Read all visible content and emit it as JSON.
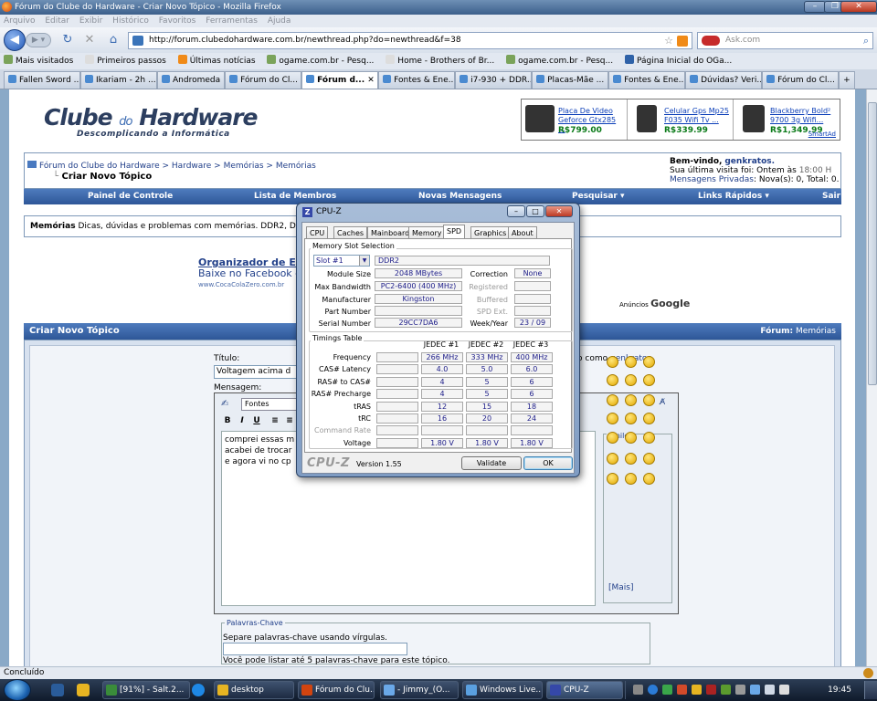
{
  "window": {
    "title": "Fórum do Clube do Hardware - Criar Novo Tópico - Mozilla Firefox"
  },
  "menu": [
    "Arquivo",
    "Editar",
    "Exibir",
    "Histórico",
    "Favoritos",
    "Ferramentas",
    "Ajuda"
  ],
  "nav": {
    "url": "http://forum.clubedohardware.com.br/newthread.php?do=newthread&f=38",
    "search_placeholder": "Ask.com"
  },
  "bookmarks": [
    "Mais visitados",
    "Primeiros passos",
    "Últimas notícias",
    "ogame.com.br - Pesq...",
    "Home - Brothers of Br...",
    "ogame.com.br - Pesq...",
    "Página Inicial do OGa..."
  ],
  "tabs": [
    {
      "label": "Fallen Sword ...",
      "active": false
    },
    {
      "label": "Ikariam - 2h ...",
      "active": false
    },
    {
      "label": "Andromeda",
      "active": false
    },
    {
      "label": "Fórum do Cl...",
      "active": false
    },
    {
      "label": "Fórum d...",
      "active": true
    },
    {
      "label": "Fontes & Ene...",
      "active": false
    },
    {
      "label": "i7-930 + DDR...",
      "active": false
    },
    {
      "label": "Placas-Mãe ...",
      "active": false
    },
    {
      "label": "Fontes & Ene...",
      "active": false
    },
    {
      "label": "Dúvidas? Veri...",
      "active": false
    },
    {
      "label": "Fórum do Cl...",
      "active": false
    }
  ],
  "site": {
    "logo_a": "Clube",
    "logo_do": "do",
    "logo_b": "Hardware",
    "slogan": "Descomplicando a Informática",
    "ads": [
      {
        "title": "Placa De Video Geforce Gtx285 ...",
        "price": "R$799.00"
      },
      {
        "title": "Celular Gps Mp25 F035 Wifi Tv ...",
        "price": "R$339.99"
      },
      {
        "title": "Blackberry Bold² 9700 3g Wifi...",
        "price": "R$1,349.99"
      }
    ],
    "smartad": "SmartAd",
    "breadcrumb": "Fórum do Clube do Hardware > Hardware > Memórias > Memórias",
    "page_title": "Criar Novo Tópico",
    "welcome_prefix": "Bem-vindo,",
    "username": "genkratos.",
    "last_visit_label": "Sua última visita foi: Ontem às",
    "last_visit_time": "18:00 H",
    "pm_label": "Mensagens Privadas",
    "pm_counts": ": Nova(s): 0, Total: 0.",
    "navstrip": [
      "Painel de Controle",
      "Lista de Membros",
      "Novas Mensagens",
      "Pesquisar ▾",
      "Links Rápidos ▾",
      "Sair"
    ],
    "forum_name": "Memórias",
    "forum_desc": "Dicas, dúvidas e problemas com memórias. DDR2, DD",
    "promo_title": "Organizador de Eve",
    "promo_sub": "Baixe no Facebook e j",
    "promo_url": "www.CocaColaZero.com.br",
    "anuncios": "Anúncios",
    "google": "Google",
    "form_title": "Criar Novo Tópico",
    "forum_label": "Fórum:",
    "forum_label_value": "Memórias",
    "title_label": "Título:",
    "title_value": "Voltagem acima d",
    "post_as": "o como",
    "post_as_user": "genkratos",
    "message_label": "Mensagem:",
    "font_select": "Fontes",
    "fmt_buttons": [
      "B",
      "I",
      "U",
      "≡",
      "≡"
    ],
    "message_lines": [
      "comprei essas m",
      "acabei de trocar",
      "e agora vi no cp"
    ],
    "smilies_label": "Smiles",
    "more_smilies": "[Mais]",
    "keywords_label": "Palavras-Chave",
    "keywords_hint": "Separe palavras-chave usando vírgulas.",
    "keywords_limit": "Você pode listar até 5 palavras-chave para este tópico."
  },
  "status": {
    "text": "Concluído"
  },
  "taskbar": {
    "buttons": [
      {
        "label": "[91%] - Salt.2...",
        "active": false
      },
      {
        "label": "desktop",
        "active": false
      },
      {
        "label": "Fórum do Clu...",
        "active": false
      },
      {
        "label": "- Jimmy_(O...",
        "active": false
      },
      {
        "label": "Windows Live...",
        "active": false
      },
      {
        "label": "CPU-Z",
        "active": true
      }
    ],
    "clock": "19:45"
  },
  "cpuz": {
    "title": "CPU-Z",
    "tabs": [
      "CPU",
      "Caches",
      "Mainboard",
      "Memory",
      "SPD",
      "Graphics",
      "About"
    ],
    "active_tab": "SPD",
    "slot_group": "Memory Slot Selection",
    "slot": "Slot #1",
    "type": "DDR2",
    "module_size_label": "Module Size",
    "module_size": "2048 MBytes",
    "max_bw_label": "Max Bandwidth",
    "max_bw": "PC2-6400 (400 MHz)",
    "manufacturer_label": "Manufacturer",
    "manufacturer": "Kingston",
    "part_label": "Part Number",
    "part": "",
    "serial_label": "Serial Number",
    "serial": "29CC7DA6",
    "correction_label": "Correction",
    "correction": "None",
    "registered_label": "Registered",
    "buffered_label": "Buffered",
    "spd_ext_label": "SPD Ext.",
    "week_year_label": "Week/Year",
    "week_year": "23 / 09",
    "timings_group": "Timings Table",
    "timing_headers": [
      "JEDEC #1",
      "JEDEC #2",
      "JEDEC #3"
    ],
    "timing_rows": [
      {
        "label": "Frequency",
        "values": [
          "266 MHz",
          "333 MHz",
          "400 MHz"
        ],
        "disabled": false
      },
      {
        "label": "CAS# Latency",
        "values": [
          "4.0",
          "5.0",
          "6.0"
        ],
        "disabled": false
      },
      {
        "label": "RAS# to CAS#",
        "values": [
          "4",
          "5",
          "6"
        ],
        "disabled": false
      },
      {
        "label": "RAS# Precharge",
        "values": [
          "4",
          "5",
          "6"
        ],
        "disabled": false
      },
      {
        "label": "tRAS",
        "values": [
          "12",
          "15",
          "18"
        ],
        "disabled": false
      },
      {
        "label": "tRC",
        "values": [
          "16",
          "20",
          "24"
        ],
        "disabled": false
      },
      {
        "label": "Command Rate",
        "values": [
          "",
          "",
          ""
        ],
        "disabled": true
      },
      {
        "label": "Voltage",
        "values": [
          "1.80 V",
          "1.80 V",
          "1.80 V"
        ],
        "disabled": false
      }
    ],
    "brand": "CPU-Z",
    "version": "Version 1.55",
    "validate": "Validate",
    "ok": "OK"
  }
}
